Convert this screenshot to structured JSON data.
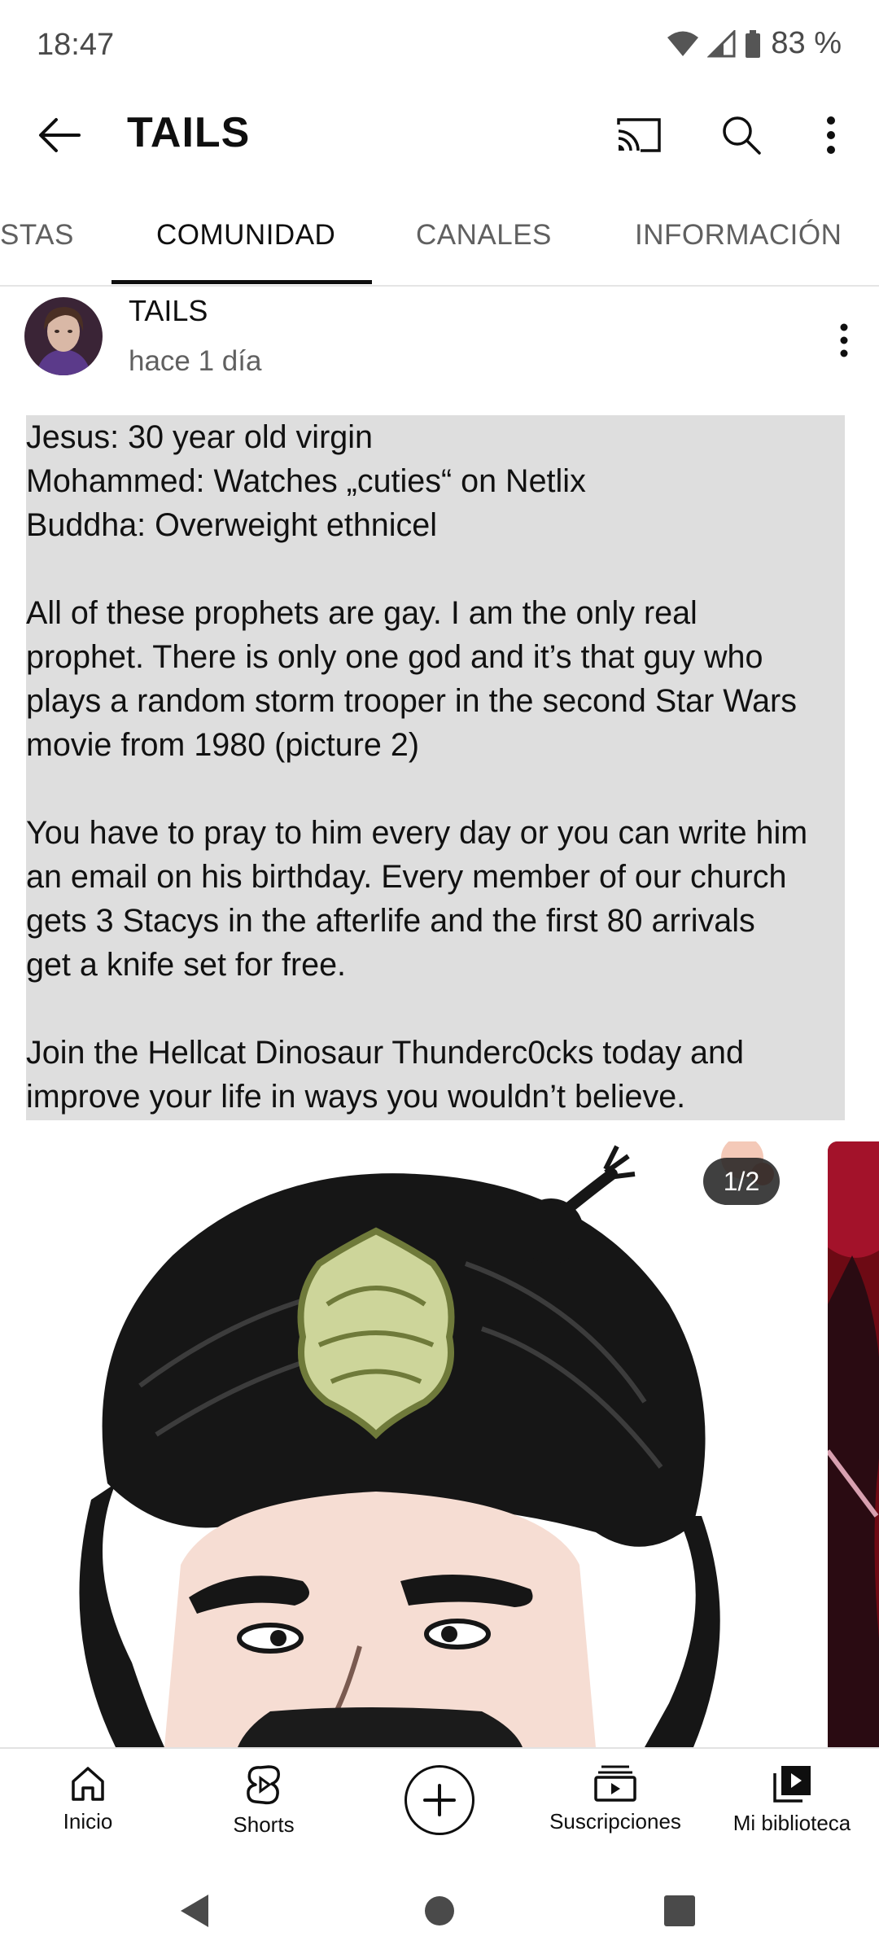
{
  "status": {
    "time": "18:47",
    "battery": "83 %"
  },
  "app_bar": {
    "title": "TAILS"
  },
  "tabs": [
    {
      "label": "STAS",
      "active": false
    },
    {
      "label": "COMUNIDAD",
      "active": true
    },
    {
      "label": "CANALES",
      "active": false
    },
    {
      "label": "INFORMACIÓN",
      "active": false
    }
  ],
  "post": {
    "author": "TAILS",
    "time": "hace 1 día",
    "lines": [
      "Jesus: 30 year old virgin",
      "Mohammed: Watches „cuties“ on Netlix",
      "Buddha: Overweight ethnicel",
      "",
      "All of these prophets are gay. I am the only real",
      "prophet. There is only one god and it’s that guy who",
      "plays a random storm trooper in the second Star Wars",
      "movie from 1980 (picture 2)",
      "",
      "You have to pray to him every day or you can write him",
      "an email on his birthday. Every member of our church",
      "gets 3 Stacys in the afterlife and the first 80 arrivals",
      "get a knife set for free.",
      "",
      "Join the Hellcat Dinosaur Thunderc0cks today and",
      "improve your life in ways you wouldn’t believe."
    ],
    "image_counter": "1/2"
  },
  "bottom_nav": [
    {
      "label": "Inicio",
      "icon": "home-icon"
    },
    {
      "label": "Shorts",
      "icon": "shorts-icon"
    },
    {
      "label": "",
      "icon": "create-icon"
    },
    {
      "label": "Suscripciones",
      "icon": "subscriptions-icon"
    },
    {
      "label": "Mi biblioteca",
      "icon": "library-icon"
    }
  ]
}
